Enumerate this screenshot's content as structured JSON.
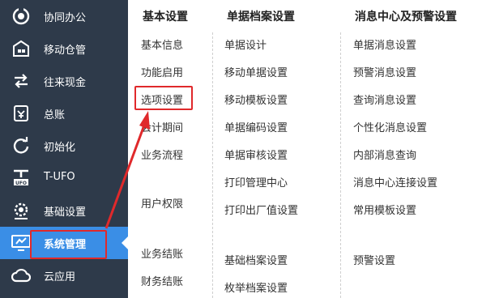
{
  "sidebar": {
    "items": [
      {
        "label": "协同办公",
        "icon": "collaboration-icon"
      },
      {
        "label": "移动仓管",
        "icon": "warehouse-icon"
      },
      {
        "label": "往来现金",
        "icon": "cash-exchange-icon"
      },
      {
        "label": "总账",
        "icon": "ledger-icon"
      },
      {
        "label": "初始化",
        "icon": "refresh-icon"
      },
      {
        "label": "T-UFO",
        "icon": "ufo-icon"
      },
      {
        "label": "基础设置",
        "icon": "gear-icon"
      },
      {
        "label": "系统管理",
        "icon": "monitor-icon",
        "active": true
      },
      {
        "label": "云应用",
        "icon": "cloud-icon"
      }
    ]
  },
  "menu": {
    "columns": [
      {
        "title": "基本设置",
        "items": [
          "基本信息",
          "功能启用",
          "选项设置",
          "会计期间",
          "业务流程",
          "用户权限",
          "业务结账",
          "财务结账"
        ]
      },
      {
        "title": "单据档案设置",
        "items": [
          "单据设计",
          "移动单据设置",
          "移动模板设置",
          "单据编码设置",
          "单据审核设置",
          "打印管理中心",
          "打印出厂值设置",
          "基础档案设置",
          "枚举档案设置"
        ]
      },
      {
        "title": "消息中心及预警设置",
        "items": [
          "单据消息设置",
          "预警消息设置",
          "查询消息设置",
          "个性化消息设置",
          "内部消息查询",
          "消息中心连接设置",
          "常用模板设置",
          "预警设置"
        ]
      }
    ]
  },
  "colors": {
    "sidebar_bg": "#2e3a4a",
    "active_bg": "#3a8ee6",
    "highlight": "#e0292b"
  }
}
